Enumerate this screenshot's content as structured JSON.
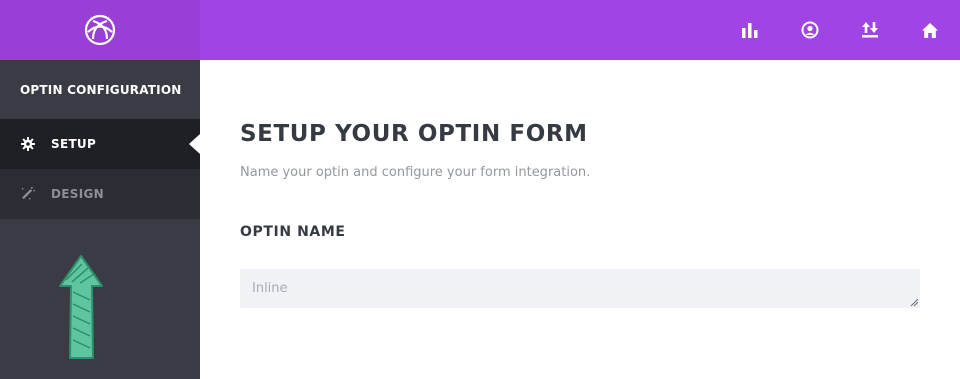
{
  "sidebar": {
    "heading": "OPTIN CONFIGURATION",
    "items": [
      {
        "label": "SETUP",
        "icon": "gear-icon",
        "active": true
      },
      {
        "label": "DESIGN",
        "icon": "magic-wand-icon",
        "active": false
      }
    ]
  },
  "topbar": {
    "icons": [
      "bar-chart-icon",
      "user-circle-icon",
      "sort-arrows-icon",
      "home-icon"
    ]
  },
  "main": {
    "title": "SETUP YOUR OPTIN FORM",
    "subtitle": "Name your optin and configure your form integration.",
    "optin_name_label": "OPTIN NAME",
    "optin_name_placeholder": "Inline"
  },
  "colors": {
    "brand": "#a044e6",
    "brand_dark": "#9a3fd6",
    "sidebar_bg": "#3a3b44",
    "nav_active_bg": "#1f2026",
    "annotation_arrow": "#5fc4a0"
  }
}
